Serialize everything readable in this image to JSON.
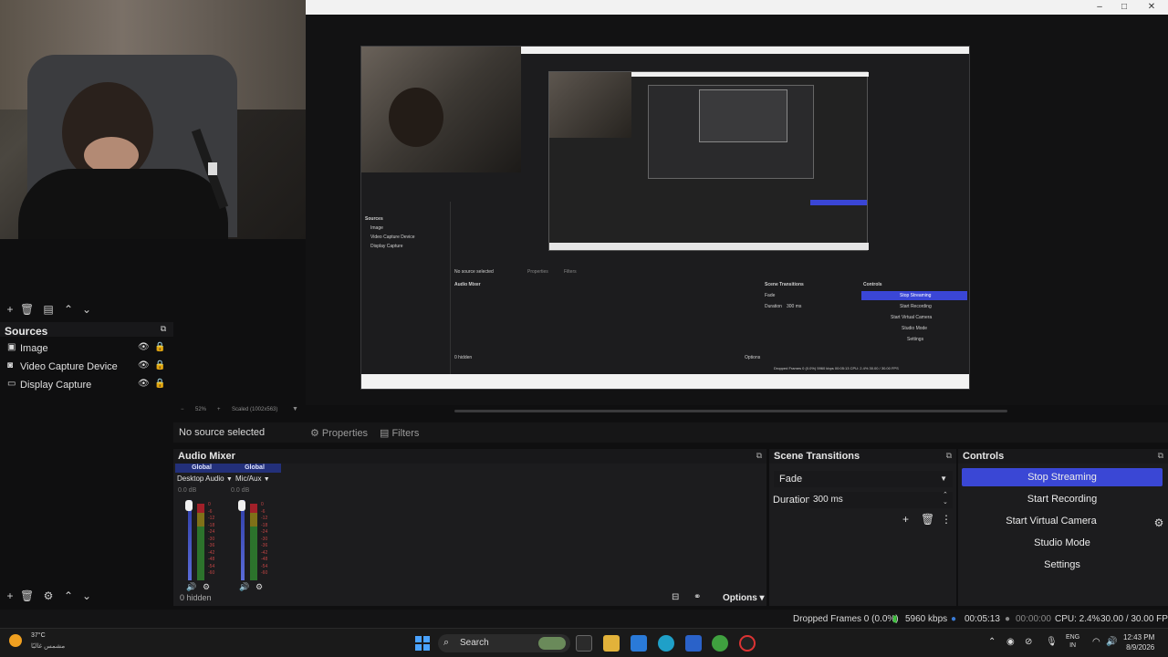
{
  "window": {
    "controls": [
      "–",
      "□",
      "✕"
    ]
  },
  "preview": {
    "inner_labels": {
      "sources": "Sources",
      "image": "Image",
      "video_capture": "Video Capture Device",
      "display_capture": "Display Capture",
      "no_source": "No source selected",
      "properties": "Properties",
      "filters": "Filters",
      "audio_mixer": "Audio Mixer",
      "scene_transitions": "Scene Transitions",
      "controls": "Controls",
      "stop_streaming": "Stop Streaming",
      "start_recording": "Start Recording",
      "start_virtual_camera": "Start Virtual Camera",
      "studio_mode": "Studio Mode",
      "settings": "Settings",
      "fade": "Fade",
      "duration": "Duration",
      "duration_value": "300 ms",
      "options": "Options",
      "hidden": "0 hidden",
      "status": "Dropped Frames 0 (0.0%)  5960 kbps  00:05:13  CPU: 2.4%  30.00 / 30.00 FPS"
    }
  },
  "zoombar": {
    "zoom": "52%",
    "scale_label": "Scaled (1002x563)"
  },
  "sources": {
    "header": "Sources",
    "items": [
      {
        "label": "Image",
        "icon": "image-icon"
      },
      {
        "label": "Video Capture Device",
        "icon": "camera-icon"
      },
      {
        "label": "Display Capture",
        "icon": "monitor-icon"
      }
    ]
  },
  "source_toolbar": {
    "no_source": "No source selected",
    "properties": "Properties",
    "filters": "Filters"
  },
  "audio_mixer": {
    "title": "Audio Mixer",
    "channels": [
      {
        "group": "Global",
        "name": "Desktop Audio",
        "db": "0.0 dB"
      },
      {
        "group": "Global",
        "name": "Mic/Aux",
        "db": "0.0 dB"
      }
    ],
    "ticks": [
      "0",
      "-6",
      "-12",
      "-18",
      "-24",
      "-30",
      "-36",
      "-42",
      "-48",
      "-54",
      "-60"
    ],
    "hidden": "0 hidden",
    "options": "Options"
  },
  "scene_transitions": {
    "title": "Scene Transitions",
    "transition": "Fade",
    "duration_label": "Duration",
    "duration_value": "300 ms"
  },
  "controls": {
    "title": "Controls",
    "stop_streaming": "Stop Streaming",
    "start_recording": "Start Recording",
    "start_virtual_camera": "Start Virtual Camera",
    "studio_mode": "Studio Mode",
    "settings": "Settings"
  },
  "status": {
    "dropped": "Dropped Frames 0 (0.0%)",
    "bitrate": "5960 kbps",
    "stream_time": "00:05:13",
    "rec_time": "00:00:00",
    "cpu": "CPU: 2.4%",
    "fps": "30.00 / 30.00 FPS"
  },
  "taskbar": {
    "temperature": "37°C",
    "weather_text": "مشمس غالبًا",
    "search": "Search",
    "lang1": "ENG",
    "lang2": "IN",
    "time": "12:43 PM",
    "date": "8/9/2026"
  },
  "colors": {
    "accent": "#3a47d5",
    "bg": "#1c1c1e"
  }
}
